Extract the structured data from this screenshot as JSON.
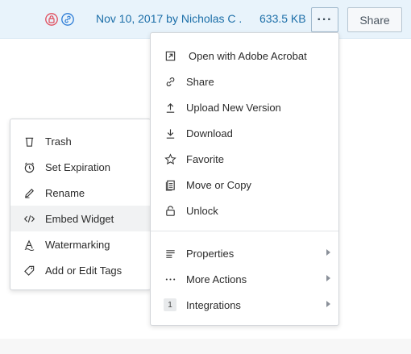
{
  "file_row": {
    "modified": "Nov 10, 2017 by Nicholas C ...",
    "size": "633.5 KB",
    "more_label": "···",
    "share_label": "Share",
    "colors": {
      "row_bg": "#e8f3fb",
      "link": "#1b6ea8",
      "lock_icon": "#e04a5a",
      "link_icon": "#2b7bd6"
    }
  },
  "main_menu": {
    "items": [
      {
        "label": "Open with Adobe Acrobat",
        "icon": "external-open-icon"
      },
      {
        "label": "Share",
        "icon": "link-icon"
      },
      {
        "label": "Upload New Version",
        "icon": "upload-icon"
      },
      {
        "label": "Download",
        "icon": "download-icon"
      },
      {
        "label": "Favorite",
        "icon": "star-icon"
      },
      {
        "label": "Move or Copy",
        "icon": "copy-icon"
      },
      {
        "label": "Unlock",
        "icon": "unlock-icon"
      }
    ],
    "submenus": [
      {
        "label": "Properties",
        "icon": "properties-icon"
      },
      {
        "label": "More Actions",
        "icon": "ellipsis-icon"
      },
      {
        "label": "Integrations",
        "icon": "integrations-badge",
        "badge": "1"
      }
    ]
  },
  "properties_submenu": {
    "items": [
      {
        "label": "Trash",
        "icon": "trash-icon"
      },
      {
        "label": "Set Expiration",
        "icon": "clock-icon"
      },
      {
        "label": "Rename",
        "icon": "pencil-icon"
      },
      {
        "label": "Embed Widget",
        "icon": "code-icon",
        "highlighted": true
      },
      {
        "label": "Watermarking",
        "icon": "watermark-icon"
      },
      {
        "label": "Add or Edit Tags",
        "icon": "tag-icon"
      }
    ]
  }
}
